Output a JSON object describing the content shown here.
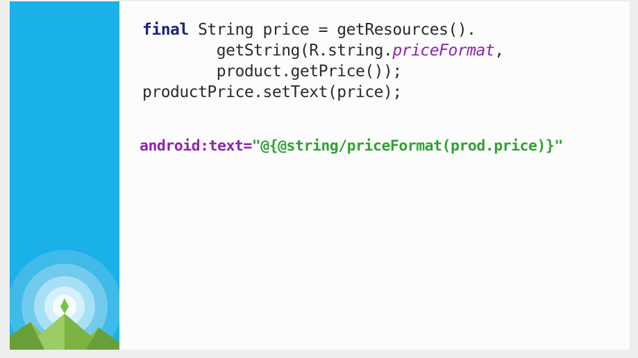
{
  "slide": {
    "code_lines": [
      {
        "keyword": "final",
        "rest": " String price = getResources()."
      },
      {
        "indent": "        ",
        "prefix": "getString(R.string.",
        "italic": "priceFormat",
        "suffix": ","
      },
      {
        "indent": "        ",
        "text": "product.getPrice());"
      },
      {
        "text": "productPrice.setText(price);"
      }
    ],
    "binding": {
      "attribute": "android:text=",
      "value": "\"@{@string/priceFormat(prod.price)}\""
    }
  },
  "colors": {
    "sidebar": "#1ab0e8",
    "keyword": "#1a237e",
    "attribute": "#8e24aa",
    "string": "#33a033",
    "code_text": "#2b2b2b"
  }
}
